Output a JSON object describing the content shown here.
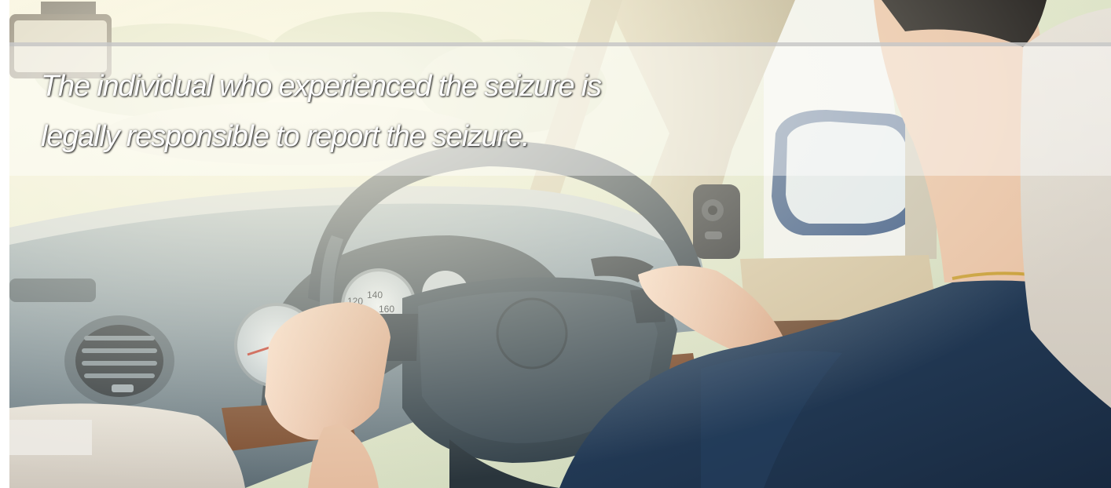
{
  "banner": {
    "caption_lines": [
      "The individual who experienced the seizure is",
      "legally responsible to report the seizure."
    ]
  },
  "colors": {
    "caption_text": "#ffffff",
    "shirt": "#1f3550",
    "dashboard": "#6c7f8a",
    "steering_wheel": "#2f3b44",
    "wood_trim": "#7a4a2c",
    "seat": "#d9d4cc"
  },
  "scene": {
    "icons": [
      "dashcam-icon",
      "side-mirror-icon",
      "steering-wheel-icon",
      "speedometer-icon",
      "air-vent-icon"
    ],
    "speedometer_marks": [
      "120",
      "140",
      "160"
    ]
  }
}
